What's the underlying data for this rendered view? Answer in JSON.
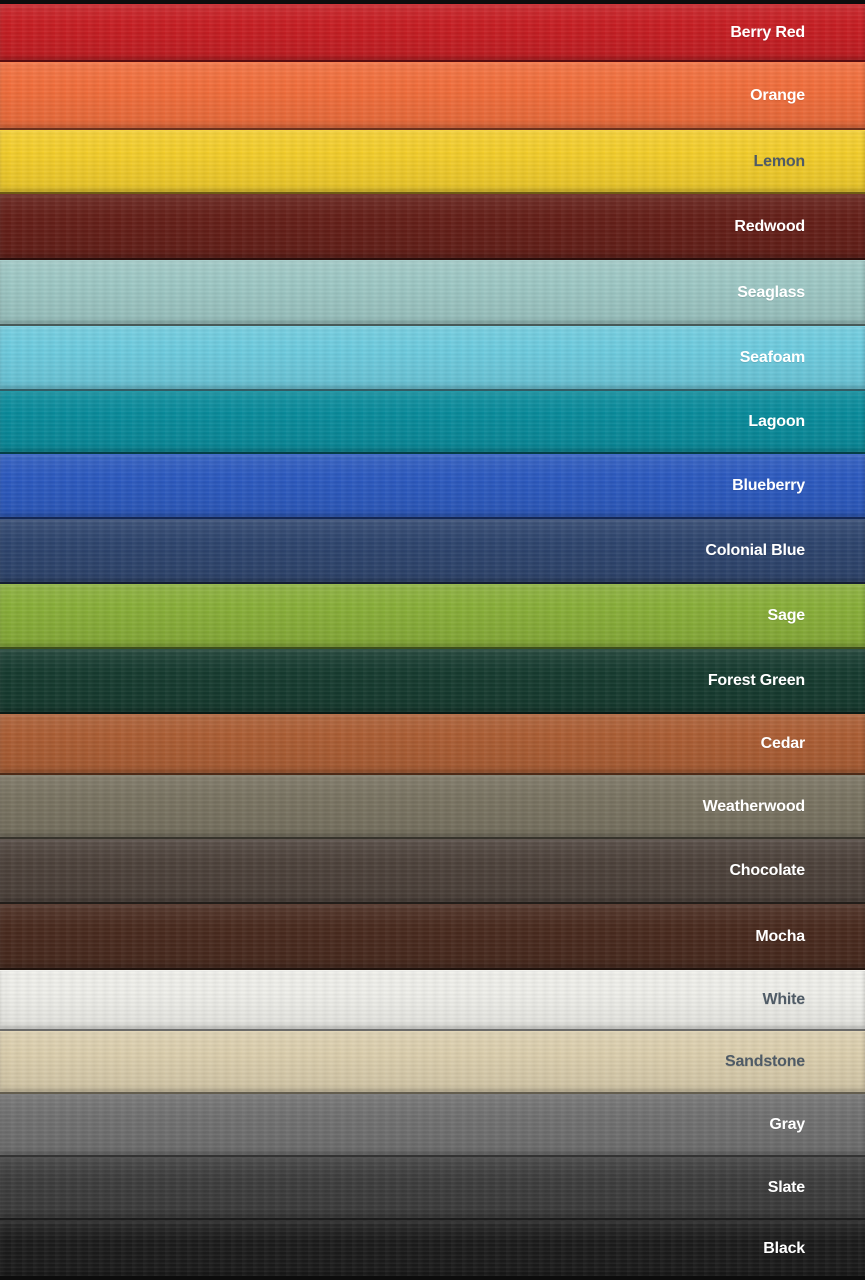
{
  "swatches": [
    {
      "label": "Berry Red",
      "color": "#c81f24",
      "text_color": "#ffffff"
    },
    {
      "label": "Orange",
      "color": "#f36f3d",
      "text_color": "#ffffff"
    },
    {
      "label": "Lemon",
      "color": "#f5cf2c",
      "text_color": "#4f5b66"
    },
    {
      "label": "Redwood",
      "color": "#662019",
      "text_color": "#ffffff"
    },
    {
      "label": "Seaglass",
      "color": "#9fc9c6",
      "text_color": "#ffffff"
    },
    {
      "label": "Seafoam",
      "color": "#6fcde0",
      "text_color": "#ffffff"
    },
    {
      "label": "Lagoon",
      "color": "#0a8d9d",
      "text_color": "#ffffff"
    },
    {
      "label": "Blueberry",
      "color": "#2d5bc1",
      "text_color": "#ffffff"
    },
    {
      "label": "Colonial Blue",
      "color": "#2f466f",
      "text_color": "#ffffff"
    },
    {
      "label": "Sage",
      "color": "#8ab03a",
      "text_color": "#ffffff"
    },
    {
      "label": "Forest Green",
      "color": "#173c30",
      "text_color": "#ffffff"
    },
    {
      "label": "Cedar",
      "color": "#ad5f35",
      "text_color": "#ffffff"
    },
    {
      "label": "Weatherwood",
      "color": "#7b7563",
      "text_color": "#ffffff"
    },
    {
      "label": "Chocolate",
      "color": "#4e433c",
      "text_color": "#ffffff"
    },
    {
      "label": "Mocha",
      "color": "#4a2b1f",
      "text_color": "#ffffff"
    },
    {
      "label": "White",
      "color": "#f0f0eb",
      "text_color": "#4f5b66"
    },
    {
      "label": "Sandstone",
      "color": "#ddd0af",
      "text_color": "#4f5b66"
    },
    {
      "label": "Gray",
      "color": "#727272",
      "text_color": "#ffffff"
    },
    {
      "label": "Slate",
      "color": "#3e3e3e",
      "text_color": "#ffffff"
    },
    {
      "label": "Black",
      "color": "#1c1c1c",
      "text_color": "#ffffff"
    }
  ]
}
